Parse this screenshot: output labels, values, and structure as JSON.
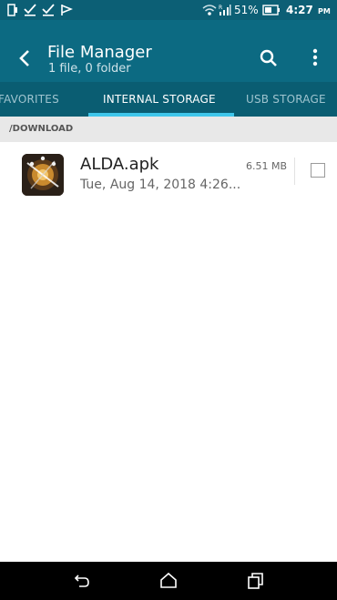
{
  "status_bar": {
    "battery": "51%",
    "time": "4:27",
    "ampm": "PM",
    "icons": [
      "screen-icon",
      "download-check-icon",
      "download-check-icon",
      "flag-icon",
      "wifi-icon",
      "signal-r-icon",
      "battery-icon"
    ]
  },
  "app_bar": {
    "title": "File Manager",
    "subtitle": "1 file, 0 folder",
    "icons": [
      "back-arrow-icon",
      "search-icon",
      "more-vert-icon"
    ]
  },
  "tabs": [
    {
      "label": "FAVORITES",
      "selected": false
    },
    {
      "label": "INTERNAL STORAGE",
      "selected": true
    },
    {
      "label": "USB STORAGE",
      "selected": false
    }
  ],
  "path": "/DOWNLOAD",
  "files": [
    {
      "name": "ALDA.apk",
      "date": "Tue, Aug 14, 2018 4:26...",
      "size": "6.51 MB",
      "icon": "apk-icon",
      "checked": false
    }
  ],
  "nav_bar": {
    "icons": [
      "back-nav-icon",
      "home-nav-icon",
      "recents-nav-icon"
    ]
  },
  "colors": {
    "status_bar": "#0c5f75",
    "app_bar": "#0c6a82",
    "tab_bar": "#0a5d72",
    "tab_indicator": "#3fc6ea",
    "path_bar": "#e8e8e8"
  }
}
